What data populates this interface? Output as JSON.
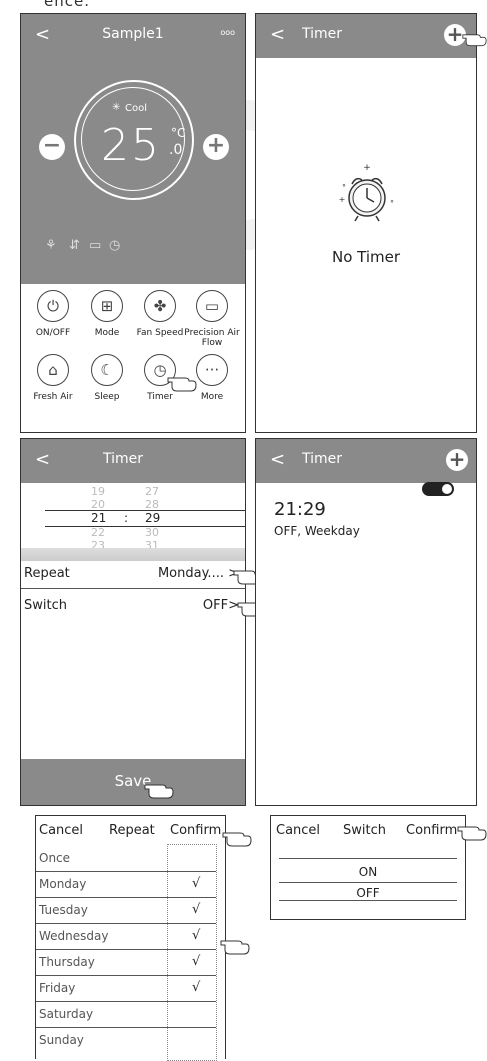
{
  "top_note": "ence.",
  "screen1": {
    "title": "Sample1",
    "back": "<",
    "menu": "ooo",
    "mode_label": "Cool",
    "temperature": "25",
    "temp_unit": "°C",
    "temp_decimal": ".0",
    "minus": "−",
    "plus": "+",
    "functions": [
      {
        "label": "ON/OFF",
        "icon": "power-icon"
      },
      {
        "label": "Mode",
        "icon": "mode-icon"
      },
      {
        "label": "Fan Speed",
        "icon": "fan-icon"
      },
      {
        "label": "Precision Air Flow",
        "icon": "airflow-icon"
      },
      {
        "label": "Fresh Air",
        "icon": "fresh-air-icon"
      },
      {
        "label": "Sleep",
        "icon": "sleep-icon"
      },
      {
        "label": "Timer",
        "icon": "timer-icon"
      },
      {
        "label": "More",
        "icon": "more-icon"
      }
    ]
  },
  "screen2": {
    "title": "Timer",
    "back": "<",
    "plus": "+",
    "empty_text": "No Timer"
  },
  "screen3": {
    "title": "Timer",
    "back": "<",
    "hours": [
      "19",
      "20",
      "21",
      "22",
      "23"
    ],
    "minutes": [
      "27",
      "28",
      "29",
      "30",
      "31"
    ],
    "separator": ":",
    "repeat_label": "Repeat",
    "repeat_value": "Monday....  >",
    "switch_label": "Switch",
    "switch_value": "OFF>",
    "save_label": "Save"
  },
  "screen4": {
    "title": "Timer",
    "back": "<",
    "plus": "+",
    "timer_time": "21:29",
    "timer_detail": "OFF, Weekday",
    "toggle_on": true
  },
  "repeat_sheet": {
    "cancel": "Cancel",
    "title": "Repeat",
    "confirm": "Confirm",
    "days": [
      {
        "label": "Once",
        "checked": false
      },
      {
        "label": "Monday",
        "checked": true
      },
      {
        "label": "Tuesday",
        "checked": true
      },
      {
        "label": "Wednesday",
        "checked": true
      },
      {
        "label": "Thursday",
        "checked": true
      },
      {
        "label": "Friday",
        "checked": true
      },
      {
        "label": "Saturday",
        "checked": false
      },
      {
        "label": "Sunday",
        "checked": false
      }
    ],
    "check_mark": "√"
  },
  "switch_sheet": {
    "cancel": "Cancel",
    "title": "Switch",
    "confirm": "Confirm",
    "options": [
      "ON",
      "OFF"
    ]
  }
}
